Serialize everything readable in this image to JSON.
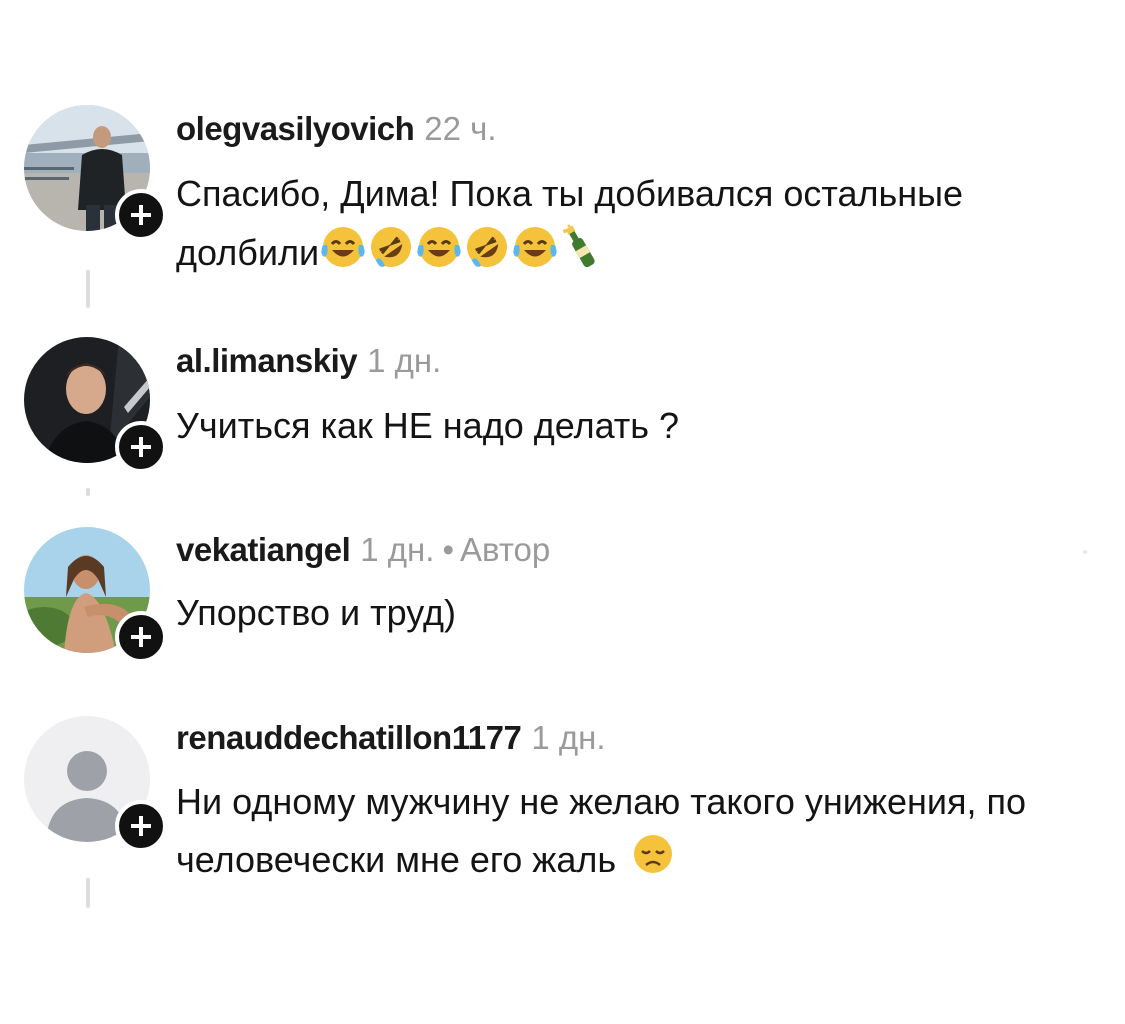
{
  "comments": [
    {
      "username": "olegvasilyovich",
      "time": "22 ч.",
      "text": "Спасибо, Дима! Пока ты добивался остальные долбили",
      "emojis": [
        "face-with-tears-of-joy",
        "rolling-on-floor-laughing",
        "face-with-tears-of-joy",
        "rolling-on-floor-laughing",
        "face-with-tears-of-joy",
        "champagne-bottle"
      ],
      "avatar": "photo-man-outdoor"
    },
    {
      "username": "al.limanskiy",
      "time": "1 дн.",
      "text": "Учиться как НЕ надо делать ?",
      "emojis": [],
      "avatar": "photo-man-dark"
    },
    {
      "username": "vekatiangel",
      "time": "1 дн.",
      "separator": "•",
      "author_label": "Автор",
      "text": "Упорство и труд)",
      "emojis": [],
      "avatar": "photo-woman-outdoor"
    },
    {
      "username": "renauddechatillon1177",
      "time": "1 дн.",
      "text": "Ни одному мужчину не желаю такого унижения, по человечески мне его жаль",
      "emojis": [
        "disappointed-face"
      ],
      "avatar": "default-user"
    }
  ],
  "colors": {
    "text": "#141414",
    "muted": "#9a9a9a",
    "badge": "#111111",
    "thread_line": "#dcdcdc",
    "emoji_yellow": "#f5c33b"
  }
}
